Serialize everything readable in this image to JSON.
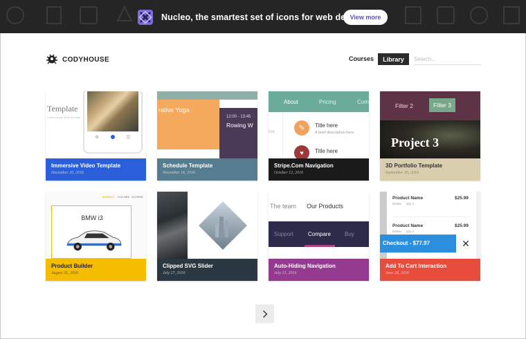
{
  "banner": {
    "text": "Nucleo, the smartest set of icons for web designers.",
    "button_label": "View more"
  },
  "header": {
    "logo_text": "CODYHOUSE",
    "nav_courses": "Courses",
    "nav_library": "Library",
    "search_placeholder": "Search..."
  },
  "cards": [
    {
      "title": "Immersive Video Template",
      "date": "December 20, 2016",
      "color": "#2b5fd9",
      "thumb": {
        "text": "Template",
        "small": "Lorem ipsum dolor sit amet"
      }
    },
    {
      "title": "Schedule Template",
      "date": "November 16, 2016",
      "color": "#567d8f",
      "thumb": {
        "text": "rative Yoga",
        "time": "12:00 - 13:45",
        "event": "Rowing W"
      }
    },
    {
      "title": "Stripe.Com Navigation",
      "date": "October 12, 2016",
      "color": "#1a1a1a",
      "thumb": {
        "tabs": [
          "About",
          "Pricing",
          "Com"
        ],
        "item1": "Title here",
        "desc1": "A brief description here",
        "item2": "Title here"
      }
    },
    {
      "title": "3D Portfolio Template",
      "date": "September 20, 2016",
      "color": "#d9cfae",
      "thumb": {
        "filter1": "Filter 2",
        "filter2": "Filter 3",
        "project": "Project 3"
      }
    },
    {
      "title": "Product Builder",
      "date": "August 31, 2016",
      "color": "#f4bd00",
      "thumb": {
        "tabs": [
          "MODELS",
          "COLORS",
          "ACCESS"
        ],
        "model": "BMW i3"
      }
    },
    {
      "title": "Clipped SVG Slider",
      "date": "July 27, 2016",
      "color": "#2c3841"
    },
    {
      "title": "Auto-Hiding Navigation",
      "date": "July 13, 2016",
      "color": "#943b90",
      "thumb": {
        "top1": "The team",
        "top2": "Our Products",
        "nav": [
          "Support",
          "Compare",
          "Buy"
        ]
      }
    },
    {
      "title": "Add To Cart Interaction",
      "date": "June 28, 2016",
      "color": "#e84c3d",
      "thumb": {
        "product": "Product Name",
        "price": "$25.99",
        "delete": "Delete",
        "qty": "Qty 1",
        "checkout": "Checkout - $77.97"
      }
    }
  ],
  "pager": {
    "icon": "chevron-right-icon"
  }
}
